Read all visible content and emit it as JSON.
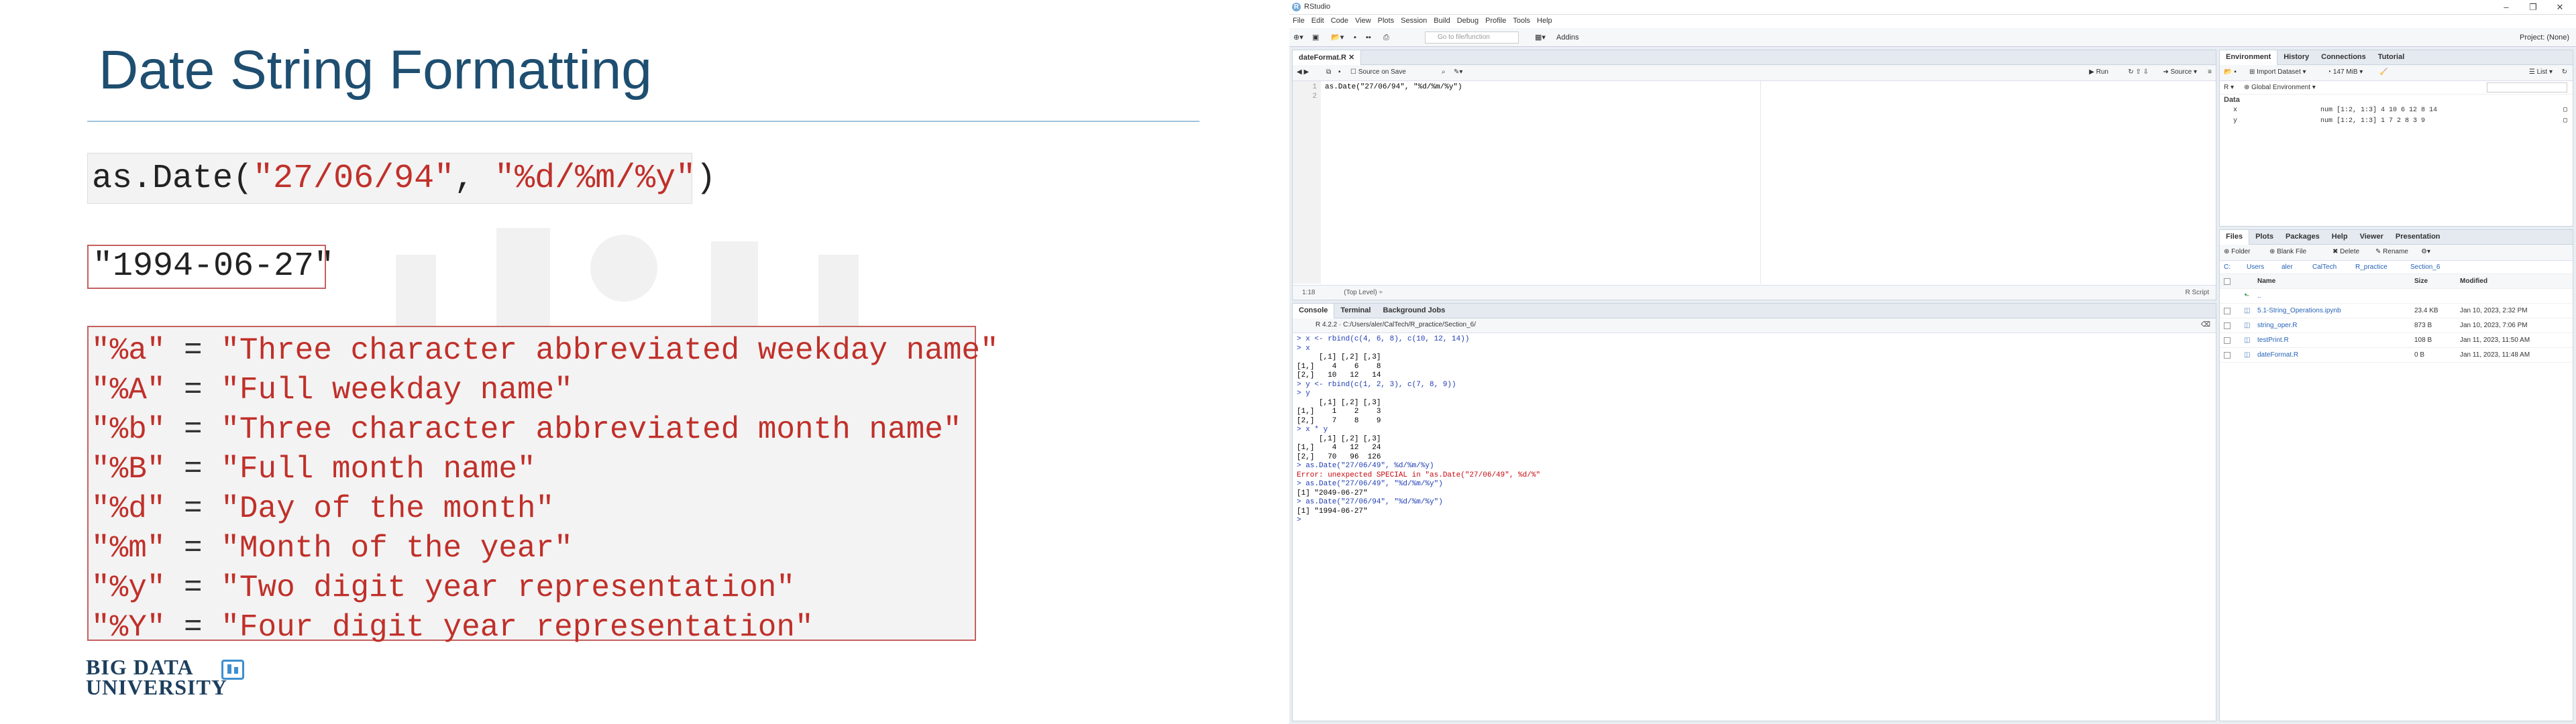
{
  "slide": {
    "title": "Date String Formatting",
    "code_fn": "as.Date(",
    "code_arg1": "\"27/06/94\"",
    "code_sep": ", ",
    "code_arg2": "\"%d/%m/%y\"",
    "code_close": ")",
    "result": "\"1994-06-27\"",
    "formats": [
      {
        "code": "\"%a\"",
        "desc": "\"Three character abbreviated weekday name\""
      },
      {
        "code": "\"%A\"",
        "desc": "\"Full weekday name\""
      },
      {
        "code": "\"%b\"",
        "desc": "\"Three character abbreviated month name\""
      },
      {
        "code": "\"%B\"",
        "desc": "\"Full month name\""
      },
      {
        "code": "\"%d\"",
        "desc": "\"Day of the month\""
      },
      {
        "code": "\"%m\"",
        "desc": "\"Month of the year\""
      },
      {
        "code": "\"%y\"",
        "desc": "\"Two digit year representation\""
      },
      {
        "code": "\"%Y\"",
        "desc": "\"Four digit year representation\""
      }
    ],
    "equals": "=",
    "logo_line1": "BIG DATA",
    "logo_line2": "UNIVERSITY"
  },
  "rstudio": {
    "app_title": "RStudio",
    "menu": [
      "File",
      "Edit",
      "Code",
      "View",
      "Plots",
      "Session",
      "Build",
      "Debug",
      "Profile",
      "Tools",
      "Help"
    ],
    "toolbar": {
      "goto_placeholder": "Go to file/function",
      "addins": "Addins",
      "project": "Project: (None)"
    },
    "editor": {
      "tab": "dateFormat.R",
      "source_on_save": "Source on Save",
      "run": "Run",
      "source": "Source",
      "lines": [
        "1",
        "2"
      ],
      "code": "as.Date(\"27/06/94\", \"%d/%m/%y\")",
      "status_pos": "1:18",
      "status_scope": "(Top Level)",
      "status_type": "R Script"
    },
    "console": {
      "tabs": [
        "Console",
        "Terminal",
        "Background Jobs"
      ],
      "path": "R 4.2.2 · C:/Users/aler/CalTech/R_practice/Section_6/",
      "lines": [
        {
          "t": "cmd",
          "s": "> x <- rbind(c(4, 6, 8), c(10, 12, 14))"
        },
        {
          "t": "cmd",
          "s": "> x"
        },
        {
          "t": "out",
          "s": "     [,1] [,2] [,3]"
        },
        {
          "t": "out",
          "s": "[1,]    4    6    8"
        },
        {
          "t": "out",
          "s": "[2,]   10   12   14"
        },
        {
          "t": "cmd",
          "s": "> y <- rbind(c(1, 2, 3), c(7, 8, 9))"
        },
        {
          "t": "cmd",
          "s": "> y"
        },
        {
          "t": "out",
          "s": "     [,1] [,2] [,3]"
        },
        {
          "t": "out",
          "s": "[1,]    1    2    3"
        },
        {
          "t": "out",
          "s": "[2,]    7    8    9"
        },
        {
          "t": "cmd",
          "s": "> x * y"
        },
        {
          "t": "out",
          "s": "     [,1] [,2] [,3]"
        },
        {
          "t": "out",
          "s": "[1,]    4   12   24"
        },
        {
          "t": "out",
          "s": "[2,]   70   96  126"
        },
        {
          "t": "cmd",
          "s": "> as.Date(\"27/06/49\", %d/%m/%y)"
        },
        {
          "t": "err",
          "s": "Error: unexpected SPECIAL in \"as.Date(\"27/06/49\", %d/%\""
        },
        {
          "t": "cmd",
          "s": "> as.Date(\"27/06/49\", \"%d/%m/%y\")"
        },
        {
          "t": "out",
          "s": "[1] \"2049-06-27\""
        },
        {
          "t": "cmd",
          "s": "> as.Date(\"27/06/94\", \"%d/%m/%y\")"
        },
        {
          "t": "out",
          "s": "[1] \"1994-06-27\""
        },
        {
          "t": "cmd",
          "s": "> "
        }
      ]
    },
    "environment": {
      "tabs": [
        "Environment",
        "History",
        "Connections",
        "Tutorial"
      ],
      "import": "Import Dataset",
      "memory": "147 MiB",
      "list": "List",
      "scope": "Global Environment",
      "section": "Data",
      "vars": [
        {
          "name": "x",
          "value": "num [1:2, 1:3] 4 10 6 12 8 14"
        },
        {
          "name": "y",
          "value": "num [1:2, 1:3] 1 7 2 8 3 9"
        }
      ]
    },
    "files": {
      "tabs": [
        "Files",
        "Plots",
        "Packages",
        "Help",
        "Viewer",
        "Presentation"
      ],
      "tools": [
        "Folder",
        "Blank File",
        "Delete",
        "Rename"
      ],
      "breadcrumb": [
        "C:",
        "Users",
        "aler",
        "CalTech",
        "R_practice",
        "Section_6"
      ],
      "headers": {
        "name": "Name",
        "size": "Size",
        "modified": "Modified"
      },
      "up": "..",
      "rows": [
        {
          "name": "5.1-String_Operations.ipynb",
          "size": "23.4 KB",
          "modified": "Jan 10, 2023, 2:32 PM"
        },
        {
          "name": "string_oper.R",
          "size": "873 B",
          "modified": "Jan 10, 2023, 7:06 PM"
        },
        {
          "name": "testPrint.R",
          "size": "108 B",
          "modified": "Jan 11, 2023, 11:50 AM"
        },
        {
          "name": "dateFormat.R",
          "size": "0 B",
          "modified": "Jan 11, 2023, 11:48 AM"
        }
      ]
    }
  }
}
